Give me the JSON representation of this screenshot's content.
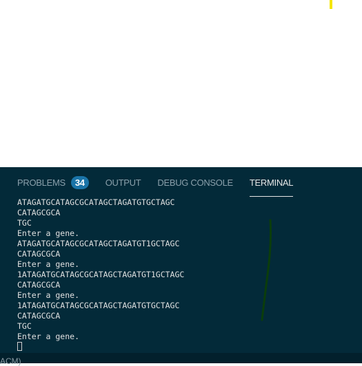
{
  "panel": {
    "tabs": [
      {
        "label": "PROBLEMS",
        "badge": "34"
      },
      {
        "label": "OUTPUT"
      },
      {
        "label": "DEBUG CONSOLE"
      },
      {
        "label": "TERMINAL",
        "active": true
      }
    ]
  },
  "terminal": {
    "lines": [
      "ATAGATGCATAGCGCATAGCTAGATGTGCTAGC",
      "CATAGCGCA",
      "TGC",
      "Enter a gene.",
      "ATAGATGCATAGCGCATAGCTAGATGT1GCTAGC",
      "CATAGCGCA",
      "Enter a gene.",
      "1ATAGATGCATAGCGCATAGCTAGATGT1GCTAGC",
      "CATAGCGCA",
      "Enter a gene.",
      "1ATAGATGCATAGCGCATAGCTAGATGTGCTAGC",
      "CATAGCGCA",
      "TGC",
      "Enter a gene."
    ]
  },
  "status": {
    "text": "(ACM)"
  },
  "colors": {
    "panel_bg": "#032a39",
    "badge": "#1a74a8",
    "highlight": "#f5e600",
    "annotation": "#0b3d0b"
  }
}
